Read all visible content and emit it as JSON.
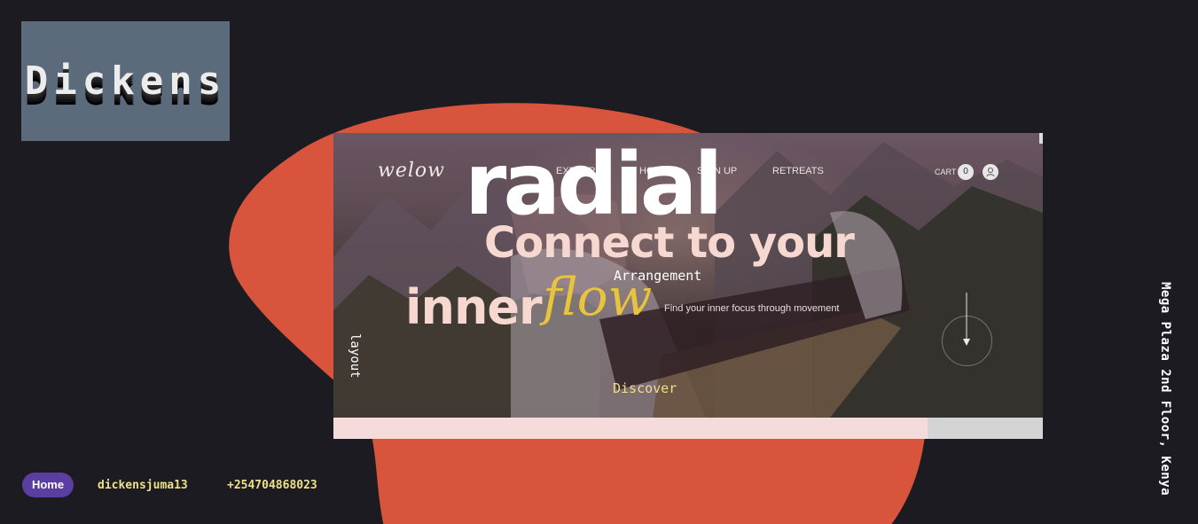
{
  "logo": {
    "text": "Dickens"
  },
  "hero": {
    "brand": "welow",
    "nav": [
      {
        "label": "EXPLORE"
      },
      {
        "label": "HOP"
      },
      {
        "label": "SIGN UP"
      },
      {
        "label": "RETREATS"
      }
    ],
    "cart": {
      "label": "CART",
      "count": "0"
    },
    "title_overlay": "radial",
    "headline_line1": "Connect to your",
    "headline_line2": "inner",
    "headline_script": "flow",
    "overlay_label": "Arrangement",
    "subtitle": "Find your inner focus through movement",
    "cta": "Discover",
    "side_label": "layout"
  },
  "address": "Mega Plaza 2nd Floor, Kenya",
  "footer": {
    "home_label": "Home",
    "handle": "dickensjuma13",
    "phone": "+254704868023"
  },
  "colors": {
    "background": "#1c1b21",
    "blob": "#d9543d",
    "accent_purple": "#5a3ea0",
    "accent_yellow": "#efe08a",
    "logo_bg": "#5b6b7b"
  }
}
